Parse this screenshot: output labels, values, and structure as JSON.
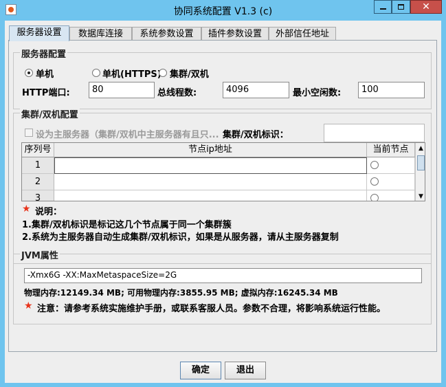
{
  "window": {
    "title": "协同系统配置 V1.3 (c)",
    "close_glyph": "✕"
  },
  "tabs": [
    "服务器设置",
    "数据库连接",
    "系统参数设置",
    "插件参数设置",
    "外部信任地址"
  ],
  "server": {
    "group_title": "服务器配置",
    "modes": [
      {
        "label": "单机",
        "selected": true
      },
      {
        "label": "单机(HTTPS)",
        "selected": false
      },
      {
        "label": "集群/双机",
        "selected": false
      }
    ],
    "http_port_label": "HTTP端口:",
    "http_port": "80",
    "total_threads_label": "总线程数:",
    "total_threads": "4096",
    "min_idle_label": "最小空闲数:",
    "min_idle": "100"
  },
  "cluster": {
    "group_title": "集群/双机配置",
    "set_master_label": "设为主服务器（集群/双机中主服务器有且只...",
    "cluster_id_label": "集群/双机标识：",
    "cluster_id_value": "",
    "table": {
      "headers": [
        "序列号",
        "节点ip地址",
        "当前节点"
      ],
      "rows": [
        {
          "seq": "1",
          "ip": "",
          "current": false
        },
        {
          "seq": "2",
          "ip": "",
          "current": false
        },
        {
          "seq": "3",
          "ip": "",
          "current": false
        }
      ]
    },
    "note_title": "说明：",
    "note_lines": [
      "1.集群/双机标识是标记这几个节点属于同一个集群簇",
      "2.系统为主服务器自动生成集群/双机标识，如果是从服务器，请从主服务器复制"
    ]
  },
  "jvm": {
    "group_title": "JVM属性",
    "args": "-Xmx6G -XX:MaxMetaspaceSize=2G",
    "memory_info": "物理内存:12149.34 MB; 可用物理内存:3855.95 MB; 虚拟内存:16245.34 MB",
    "warning": "注意：请参考系统实施维护手册，或联系客服人员。参数不合理，将影响系统运行性能。"
  },
  "buttons": {
    "ok": "确定",
    "exit": "退出"
  },
  "colors": {
    "titlebar": "#6fc4ee",
    "close": "#c7504a",
    "star": "#e8331b"
  }
}
